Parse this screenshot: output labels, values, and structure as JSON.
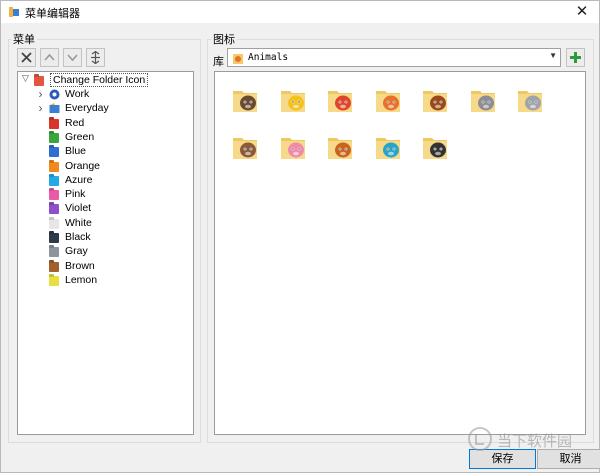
{
  "window": {
    "title": "菜单编辑器",
    "close_glyph": "✕"
  },
  "menu_panel": {
    "label": "菜单",
    "toolbar": [
      {
        "name": "delete-button",
        "icon": "x-icon"
      },
      {
        "name": "move-up-button",
        "icon": "chevron-up-icon"
      },
      {
        "name": "move-down-button",
        "icon": "chevron-down-icon"
      },
      {
        "name": "separator-button",
        "icon": "separator-icon"
      }
    ],
    "tree": {
      "root": "Change Folder Icon",
      "items": [
        {
          "label": "Work",
          "kind": "group",
          "icon": "work-badge-icon"
        },
        {
          "label": "Everyday",
          "kind": "group",
          "icon": "everyday-badge-icon"
        },
        {
          "label": "Red",
          "color": "#d9362b"
        },
        {
          "label": "Green",
          "color": "#3aa53a"
        },
        {
          "label": "Blue",
          "color": "#2f6fd0"
        },
        {
          "label": "Orange",
          "color": "#f08a1c"
        },
        {
          "label": "Azure",
          "color": "#22a9e6"
        },
        {
          "label": "Pink",
          "color": "#ea5ca8"
        },
        {
          "label": "Violet",
          "color": "#8e4fc9"
        },
        {
          "label": "White",
          "color": "#e6e6e6"
        },
        {
          "label": "Black",
          "color": "#2f3a48"
        },
        {
          "label": "Gray",
          "color": "#8e959c"
        },
        {
          "label": "Brown",
          "color": "#a0612e"
        },
        {
          "label": "Lemon",
          "color": "#e8e040"
        }
      ]
    }
  },
  "icons_panel": {
    "label": "图标",
    "library_label": "库",
    "library_value": "Animals",
    "add_glyph": "+",
    "icons": [
      {
        "name": "cow",
        "color": "#6b4a32"
      },
      {
        "name": "chick",
        "color": "#f4c21a"
      },
      {
        "name": "crab",
        "color": "#e0452a"
      },
      {
        "name": "fox",
        "color": "#e8702a"
      },
      {
        "name": "lion",
        "color": "#9a4a1a"
      },
      {
        "name": "hippo",
        "color": "#8d8d95"
      },
      {
        "name": "koala",
        "color": "#9fa4aa"
      },
      {
        "name": "monkey",
        "color": "#8a5a3a"
      },
      {
        "name": "pig",
        "color": "#f08aa8"
      },
      {
        "name": "squirrel",
        "color": "#c8641e"
      },
      {
        "name": "bird",
        "color": "#27a5c8"
      },
      {
        "name": "zebra",
        "color": "#333333"
      }
    ]
  },
  "buttons": {
    "save": "保存",
    "cancel": "取消"
  },
  "watermark": {
    "text": "当下软件园"
  }
}
